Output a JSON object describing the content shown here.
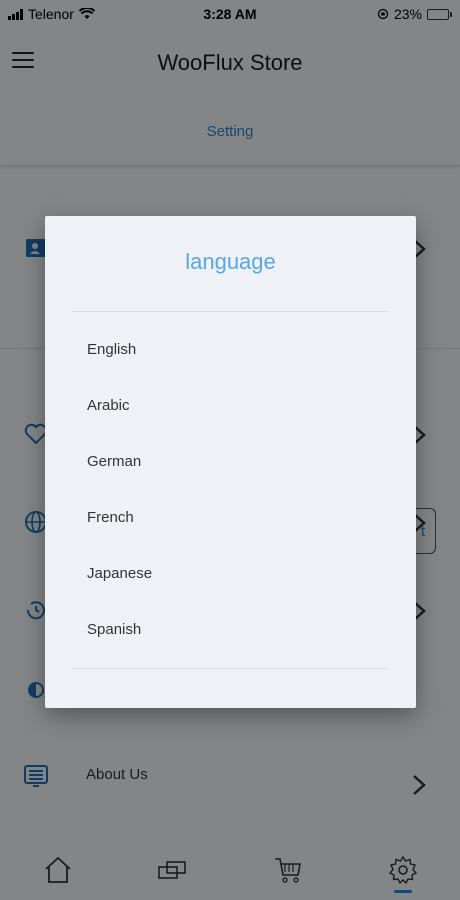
{
  "status_bar": {
    "carrier": "Telenor",
    "time": "3:28 AM",
    "battery": "23%"
  },
  "app_bar": {
    "title": "WooFlux Store"
  },
  "tab": {
    "label": "Setting"
  },
  "settings": {
    "about_label": "About Us",
    "select_button_label": "t"
  },
  "dialog": {
    "title": "language",
    "languages": [
      "English",
      "Arabic",
      "German",
      "French",
      "Japanese",
      "Spanish"
    ]
  },
  "colors": {
    "accent": "#2f83c7",
    "dialog_title": "#5aa6e0"
  }
}
